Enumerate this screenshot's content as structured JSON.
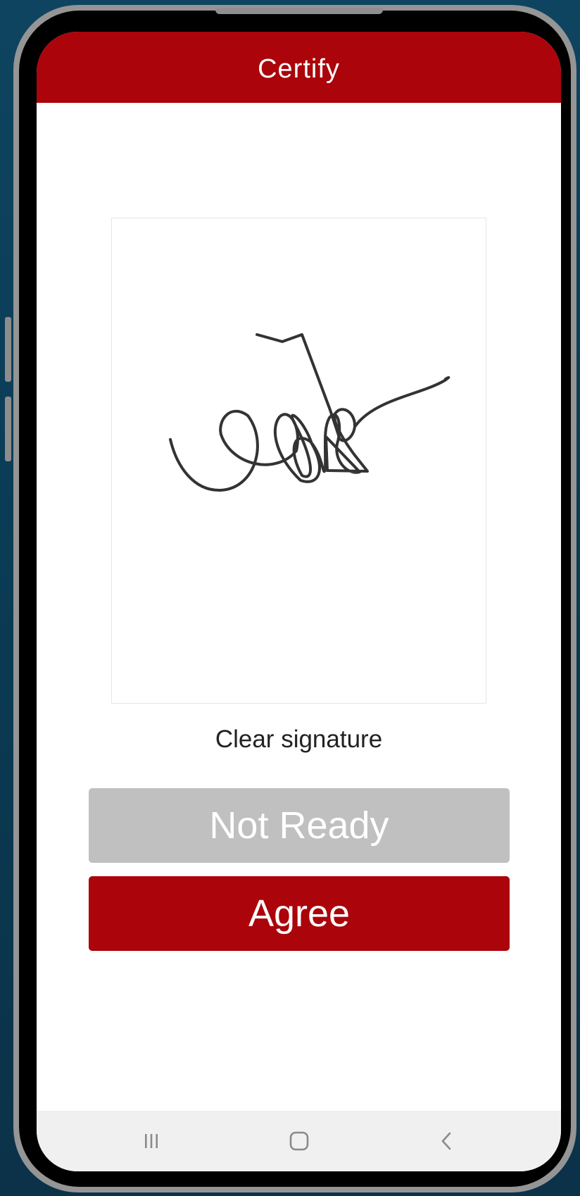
{
  "header": {
    "title": "Certify"
  },
  "signature_pad": {
    "has_signature": true,
    "stroke_color": "#333333"
  },
  "clear_label": "Clear signature",
  "buttons": {
    "not_ready_label": "Not Ready",
    "agree_label": "Agree"
  },
  "colors": {
    "brand": "#ab040a",
    "disabled": "#c0c0c0",
    "nav_bar": "#f0f0f0"
  },
  "nav": {
    "recents_icon": "recent-apps-icon",
    "home_icon": "home-icon",
    "back_icon": "back-icon"
  }
}
